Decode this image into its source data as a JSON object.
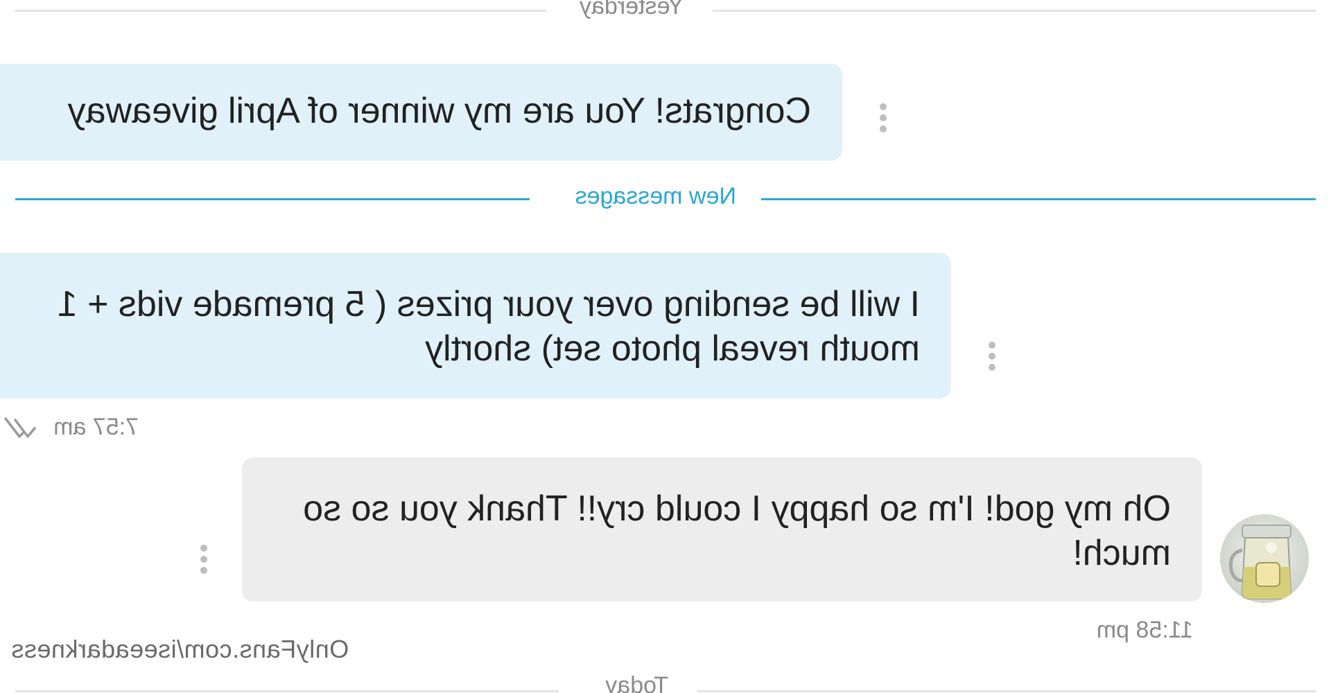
{
  "dividers": {
    "yesterday": "Yesterday",
    "new_messages": "New messages",
    "today": "Today"
  },
  "messages": [
    {
      "direction": "incoming",
      "text": "Congrats! You are my winner of April giveaway",
      "more_icon": "more-vert-icon"
    },
    {
      "direction": "incoming",
      "text": "I will be sending over your prizes ( 5 premade vids + 1 mouth reveal photo set) shortly",
      "more_icon": "more-vert-icon",
      "time": "7:57 am",
      "status_icon": "double-check-icon"
    },
    {
      "direction": "outgoing",
      "text": "Oh my god! I'm so happy I could cry!! Thank you so so much!",
      "more_icon": "more-vert-icon",
      "time": "11:58 pm",
      "avatar_icon": "avatar-jar-photo"
    }
  ],
  "watermark": "OnlyFans.com/iseeadarkness",
  "colors": {
    "incoming_bubble": "#e1f1fa",
    "outgoing_bubble": "#ededed",
    "accent": "#2aa6d5",
    "muted_text": "#8a8a8a"
  }
}
